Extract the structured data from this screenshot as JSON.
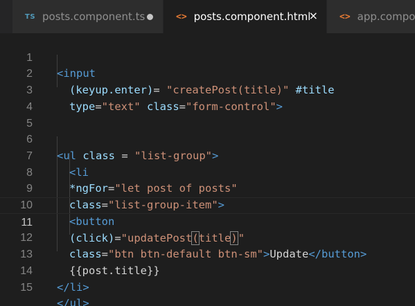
{
  "tabs": [
    {
      "icon": "TS",
      "label": "posts.component.ts",
      "state": "modified"
    },
    {
      "icon": "<>",
      "label": "posts.component.html",
      "state": "active",
      "close": "×"
    },
    {
      "icon": "<>",
      "label": "app.compone"
    }
  ],
  "editor": {
    "current_line": 11,
    "lines": [
      {
        "n": "1"
      },
      {
        "n": "2"
      },
      {
        "n": "3"
      },
      {
        "n": "4"
      },
      {
        "n": "5"
      },
      {
        "n": "6"
      },
      {
        "n": "7"
      },
      {
        "n": "8"
      },
      {
        "n": "9"
      },
      {
        "n": "10"
      },
      {
        "n": "11"
      },
      {
        "n": "12"
      },
      {
        "n": "13"
      },
      {
        "n": "14"
      },
      {
        "n": "15"
      }
    ],
    "code": {
      "l1": {
        "open": "<",
        "tag": "input"
      },
      "l2": {
        "attr": "(keyup.enter)",
        "eq": "= ",
        "str": "\"createPost(title)\"",
        "ref": " #title"
      },
      "l3": {
        "attr1": "type",
        "eq1": "=",
        "str1": "\"text\"",
        "attr2": " class",
        "eq2": "=",
        "str2": "\"form-control\"",
        "close": ">"
      },
      "l6": {
        "open": "<",
        "tag": "ul",
        "attr": " class",
        "eq": " = ",
        "str": "\"list-group\"",
        "close": ">"
      },
      "l7": {
        "open": "<",
        "tag": "li"
      },
      "l8": {
        "attr": "*ngFor",
        "eq": "=",
        "str": "\"let post of posts\""
      },
      "l9": {
        "attr": "class",
        "eq": "=",
        "str": "\"list-group-item\"",
        "close": ">"
      },
      "l10": {
        "open": "<",
        "tag": "button"
      },
      "l11": {
        "attr": "(click)",
        "eq": "=",
        "str_a": "\"updatePost",
        "paren_open": "(",
        "str_b": "title",
        "paren_close": ")",
        "str_c": "\""
      },
      "l12": {
        "attr": "class",
        "eq": "=",
        "str": "\"btn btn-default btn-sm\"",
        "close": ">",
        "text": "Update",
        "end_open": "</",
        "end_tag": "button",
        "end_close": ">"
      },
      "l13": {
        "text": "{{post.title}}"
      },
      "l14": {
        "open": "</",
        "tag": "li",
        "close": ">"
      },
      "l15": {
        "open": "</",
        "tag": "ul",
        "close": ">"
      }
    }
  },
  "colors": {
    "tag": "#569cd6",
    "attribute": "#9cdcfe",
    "string": "#ce9178",
    "text": "#d4d4d4",
    "line_number": "#858585",
    "editor_bg": "#1e1e1e",
    "ts_icon": "#519aba",
    "html_icon": "#e37933"
  }
}
